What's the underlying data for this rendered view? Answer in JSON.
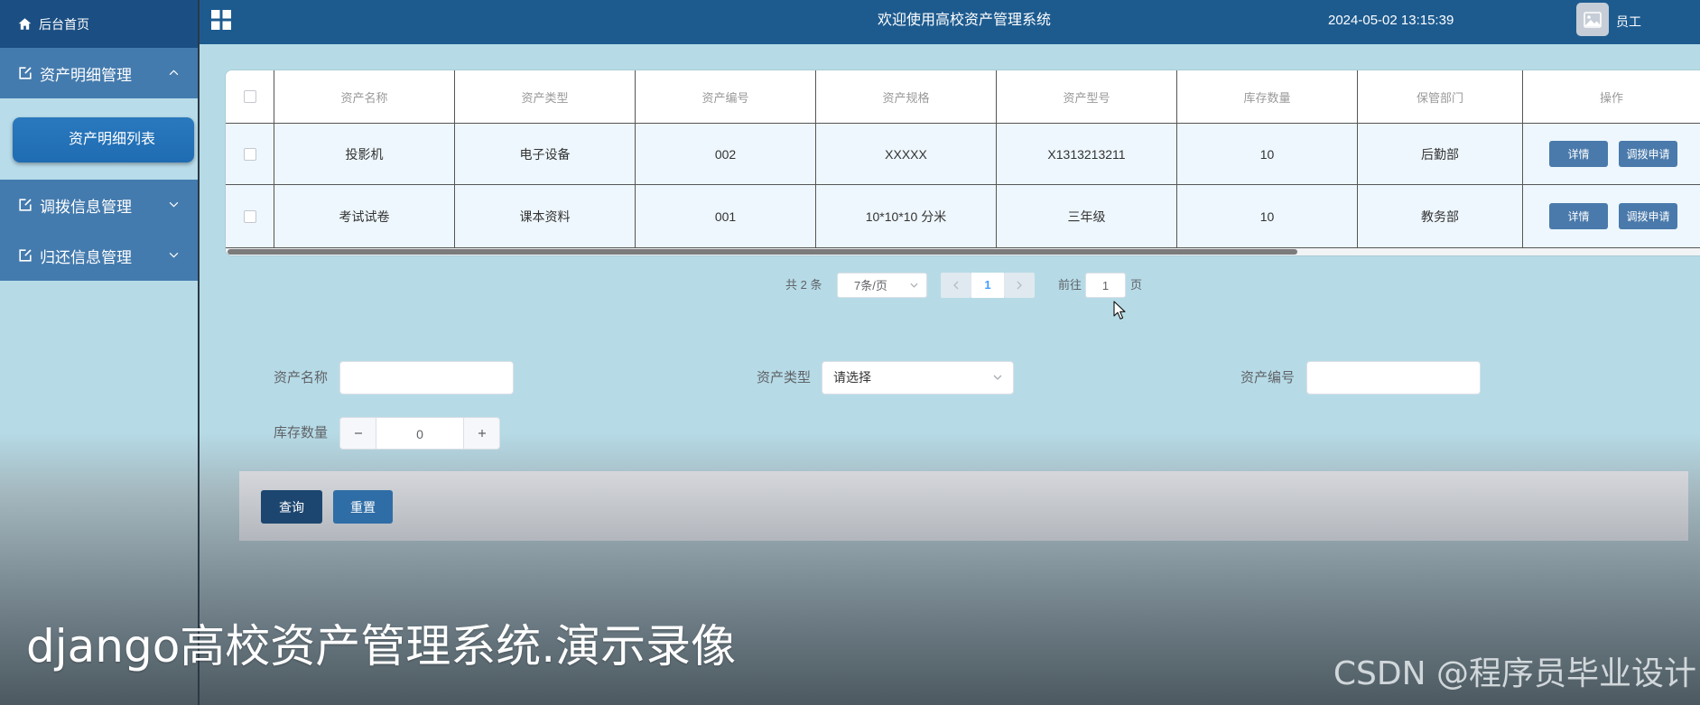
{
  "theme": {
    "header_bg": "#1d5b8f",
    "sidebar_home_bg": "#1b4f83",
    "sidebar_group_bg": "#447bae",
    "active_item_bg": "#1f6cb2",
    "page_bg": "#b6dbe7",
    "primary_button_bg": "#1c4670",
    "secondary_button_bg": "#2f6da6",
    "row_action_bg": "#4a7aab",
    "pagination_active": "#409eff"
  },
  "header": {
    "menu_toggle_icon": "grid-icon",
    "title": "欢迎使用高校资产管理系统",
    "datetime": "2024-05-02 13:15:39",
    "avatar_icon": "image-icon",
    "username": "员工"
  },
  "sidebar": {
    "home": {
      "icon": "home-icon",
      "label": "后台首页"
    },
    "menus": [
      {
        "icon": "edit-doc-icon",
        "label": "资产明细管理",
        "expanded": true,
        "chevron": "chevron-up-icon",
        "children": [
          {
            "label": "资产明细列表",
            "active": true
          }
        ]
      },
      {
        "icon": "edit-doc-icon",
        "label": "调拨信息管理",
        "expanded": false,
        "chevron": "chevron-down-icon"
      },
      {
        "icon": "edit-doc-icon",
        "label": "归还信息管理",
        "expanded": false,
        "chevron": "chevron-down-icon"
      }
    ]
  },
  "table": {
    "select_all_checked": false,
    "columns": [
      "资产名称",
      "资产类型",
      "资产编号",
      "资产规格",
      "资产型号",
      "库存数量",
      "保管部门",
      "操作"
    ],
    "rows": [
      {
        "checked": false,
        "cells": [
          "投影机",
          "电子设备",
          "002",
          "XXXXX",
          "X1313213211",
          "10",
          "后勤部"
        ],
        "actions": [
          "详情",
          "调拨申请"
        ]
      },
      {
        "checked": false,
        "cells": [
          "考试试卷",
          "课本资料",
          "001",
          "10*10*10 分米",
          "三年级",
          "10",
          "教务部"
        ],
        "actions": [
          "详情",
          "调拨申请"
        ]
      }
    ]
  },
  "pagination": {
    "total": "共 2 条",
    "page_size": "7条/页",
    "prev_icon": "chevron-left-icon",
    "next_icon": "chevron-right-icon",
    "pages": [
      {
        "label": "1",
        "active": true
      }
    ],
    "goto_label": "前往",
    "goto_value": "1",
    "goto_suffix": "页"
  },
  "search": {
    "fields": [
      {
        "label": "资产名称",
        "type": "text",
        "value": ""
      },
      {
        "label": "资产类型",
        "type": "select",
        "selected": "请选择"
      },
      {
        "label": "资产编号",
        "type": "text",
        "value": ""
      },
      {
        "label": "库存数量",
        "type": "number",
        "value": "0",
        "decrement_icon": "minus-icon",
        "increment_icon": "plus-icon"
      }
    ],
    "buttons": {
      "query": "查询",
      "reset": "重置"
    }
  },
  "overlay": {
    "caption": "django高校资产管理系统.演示录像",
    "watermark": "CSDN @程序员毕业设计"
  },
  "cursor_icon": "mouse-cursor-icon"
}
